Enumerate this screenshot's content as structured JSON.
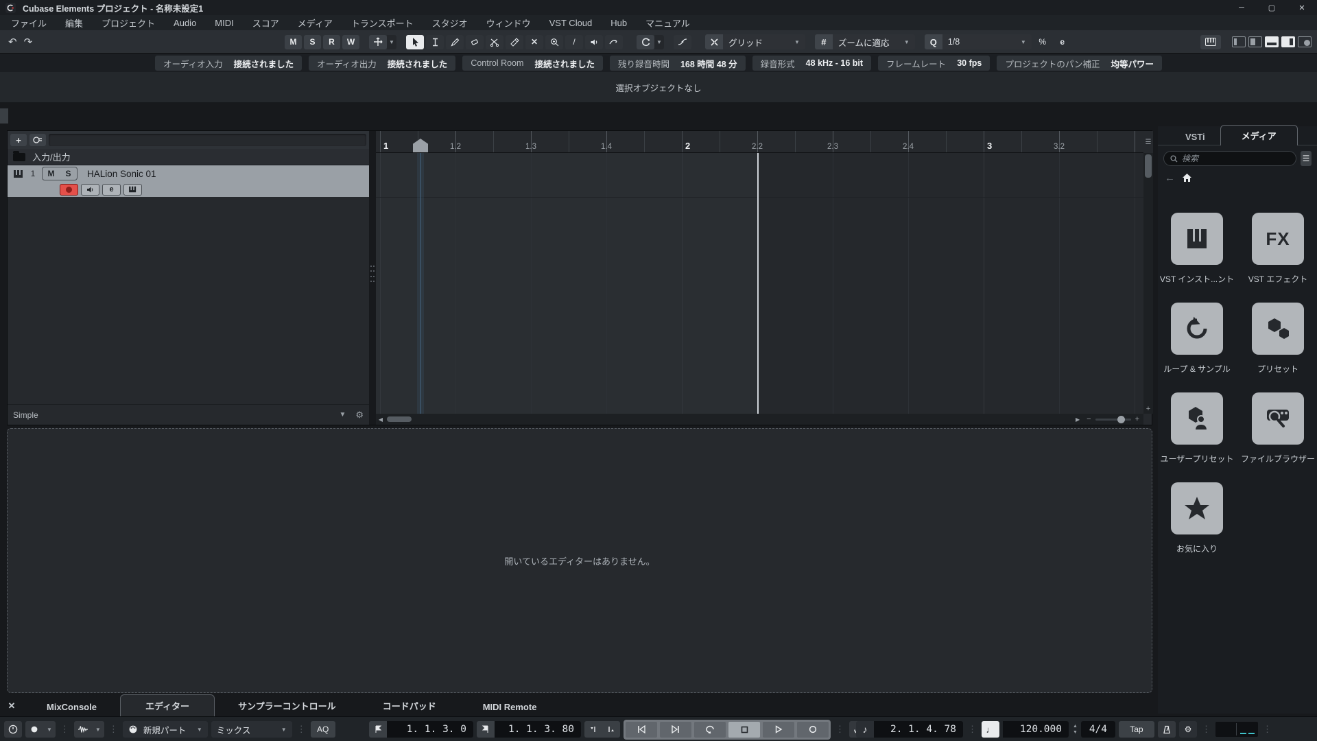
{
  "window": {
    "title": "Cubase Elements プロジェクト - 名称未設定1",
    "minimize": "─",
    "maximize": "▢",
    "close": "✕"
  },
  "menubar": {
    "items": [
      "ファイル",
      "編集",
      "プロジェクト",
      "Audio",
      "MIDI",
      "スコア",
      "メディア",
      "トランスポート",
      "スタジオ",
      "ウィンドウ",
      "VST Cloud",
      "Hub",
      "マニュアル"
    ]
  },
  "icons": {
    "undo": "↶",
    "redo": "↷",
    "chevron_down": "▼",
    "dots": "⋮",
    "mute_x": "✕",
    "line_tool": "/",
    "swing": "%",
    "edit_e": "e",
    "hash": "#",
    "q": "Q",
    "list": "☰",
    "home": "⌂",
    "back": "←",
    "plus": "+",
    "minus": "−",
    "left": "◀",
    "right": "▶",
    "gear": "⚙",
    "star": "★",
    "add": "+"
  },
  "toolbar": {
    "state_buttons": [
      "M",
      "S",
      "R",
      "W"
    ],
    "grid_label": "グリッド",
    "zoom_mode_label": "ズームに適応",
    "quantize_value": "1/8"
  },
  "statusbar": {
    "items": [
      {
        "label": "オーディオ入力",
        "value": "接続されました"
      },
      {
        "label": "オーディオ出力",
        "value": "接続されました"
      },
      {
        "label": "Control Room",
        "value": "接続されました"
      },
      {
        "label": "残り録音時間",
        "value": "168 時間 48 分"
      },
      {
        "label": "録音形式",
        "value": "48 kHz - 16 bit"
      },
      {
        "label": "フレームレート",
        "value": "30 fps"
      },
      {
        "label": "プロジェクトのパン補正",
        "value": "均等パワー"
      }
    ]
  },
  "infoline": {
    "text": "選択オブジェクトなし"
  },
  "tracklist": {
    "folder_label": "入力/出力",
    "track": {
      "number": "1",
      "name": "HALion Sonic 01",
      "mute": "M",
      "solo": "S",
      "edit": "e"
    },
    "footer_label": "Simple"
  },
  "ruler": {
    "labels": [
      "1",
      "1.2",
      "1.3",
      "1.4",
      "2",
      "2.2",
      "2.3",
      "2.4",
      "3",
      "3.2"
    ]
  },
  "media_rack": {
    "tabs": [
      "VSTi",
      "メディア"
    ],
    "active_tab": "メディア",
    "search_placeholder": "検索",
    "tiles": [
      {
        "label": "VST インスト...ント",
        "icon": "piano-icon"
      },
      {
        "label": "VST エフェクト",
        "icon": "fx-icon"
      },
      {
        "label": "ループ & サンプル",
        "icon": "loop-icon"
      },
      {
        "label": "プリセット",
        "icon": "presets-icon"
      },
      {
        "label": "ユーザープリセット",
        "icon": "user-presets-icon"
      },
      {
        "label": "ファイルブラウザー",
        "icon": "file-browser-icon"
      },
      {
        "label": "お気に入り",
        "icon": "favorites-icon"
      }
    ]
  },
  "lower_zone": {
    "message": "開いているエディターはありません。"
  },
  "bottom_tabs": {
    "tabs": [
      "MixConsole",
      "エディター",
      "サンプラーコントロール",
      "コードパッド",
      "MIDI Remote"
    ],
    "active_tab": "エディター"
  },
  "transport": {
    "part_mode": "新規パート",
    "cycle_mode": "ミックス",
    "aq_label": "AQ",
    "left_locator": "1. 1. 3.  0",
    "right_locator": "1. 1. 3. 80",
    "time": "2. 1. 4. 78",
    "tempo": "120.000",
    "time_signature": "4/4",
    "tap_label": "Tap"
  }
}
